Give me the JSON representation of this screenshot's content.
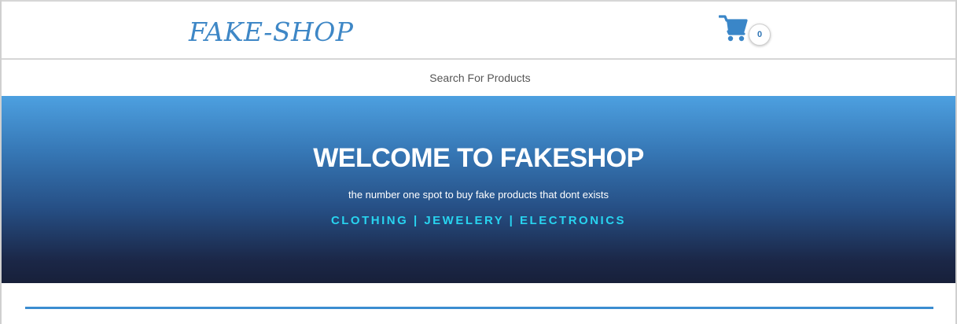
{
  "header": {
    "logo_text": "FAKE-SHOP",
    "cart_count": "0"
  },
  "search": {
    "placeholder": "Search For Products"
  },
  "hero": {
    "title": "WELCOME TO FAKESHOP",
    "subtitle": "the number one spot to buy fake products that dont exists",
    "categories": [
      {
        "label": "CLOTHING"
      },
      {
        "label": "JEWELERY"
      },
      {
        "label": "ELECTRONICS"
      }
    ],
    "separator": "|"
  },
  "colors": {
    "brand": "#3e87c6",
    "accent": "#28d4f0",
    "divider": "#3b8dd0"
  },
  "icons": {
    "cart": "shopping-cart-icon"
  }
}
